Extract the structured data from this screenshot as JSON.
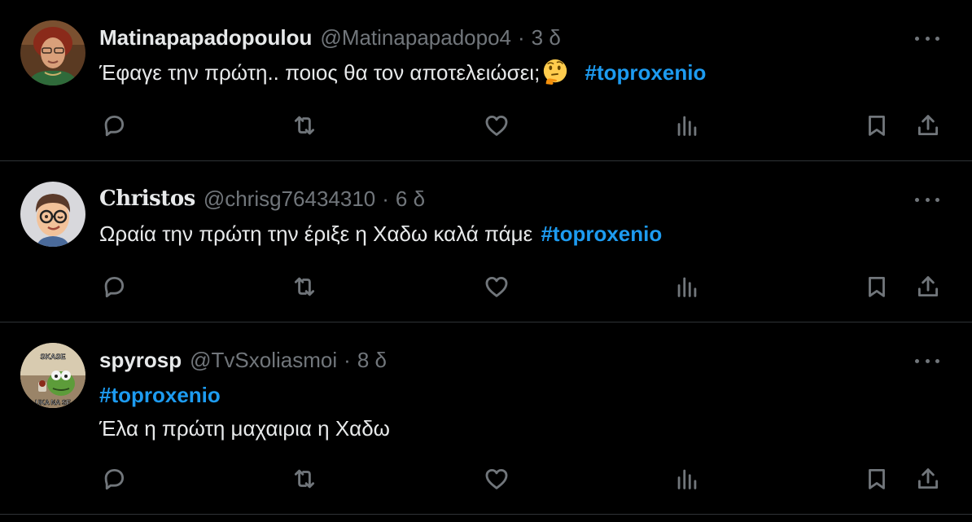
{
  "colors": {
    "background": "#000000",
    "text": "#e7e9ea",
    "muted": "#71767b",
    "hashtag": "#1d9bf0",
    "divider": "#2f3336"
  },
  "tweets": [
    {
      "name": "Matinapapadopoulou",
      "handle": "@Matinapapadopo4",
      "separator": "·",
      "time": "3 δ",
      "text": "Έφαγε την πρώτη.. ποιος θα τον αποτελειώσει;",
      "emoji_icon": "thinking-face-icon",
      "hashtag": "#toproxenio",
      "avatar_icon": "avatar-photo-woman"
    },
    {
      "name": "Christos",
      "handle": "@chrisg76434310",
      "separator": "·",
      "time": "6 δ",
      "text": "Ωραία την πρώτη την έριξε η Χαδω καλά πάμε",
      "hashtag": "#toproxenio",
      "avatar_icon": "avatar-memoji-man"
    },
    {
      "name": "spyrosp",
      "handle": "@TvSxoliasmoi",
      "separator": "·",
      "time": "8 δ",
      "hashtag": "#toproxenio",
      "text": "Έλα η πρώτη μαχαιρια η Χαδω",
      "avatar_icon": "avatar-kermit-meme",
      "avatar_caption_top": "SKASE",
      "avatar_caption_bottom": "UKA NA SE"
    }
  ],
  "action_icons": [
    "reply-icon",
    "retweet-icon",
    "like-icon",
    "views-icon",
    "bookmark-icon",
    "share-icon"
  ]
}
